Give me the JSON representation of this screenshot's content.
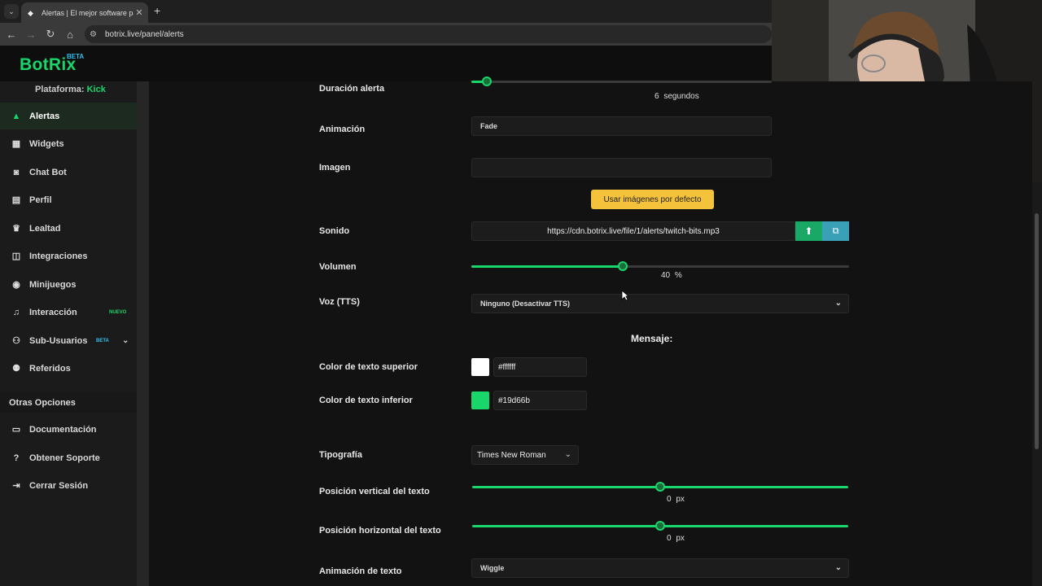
{
  "browser": {
    "tab_title": "Alertas | El mejor software para",
    "url": "botrix.live/panel/alerts"
  },
  "app": {
    "logo": "BotRix",
    "logo_badge": "BETA"
  },
  "sidebar": {
    "platform_label": "Plataforma:",
    "platform_value": "Kick",
    "items": [
      {
        "label": "Alertas",
        "icon": "warning-icon"
      },
      {
        "label": "Widgets",
        "icon": "grid-icon"
      },
      {
        "label": "Chat Bot",
        "icon": "robot-icon"
      },
      {
        "label": "Perfil",
        "icon": "id-card-icon"
      },
      {
        "label": "Lealtad",
        "icon": "trophy-icon"
      },
      {
        "label": "Integraciones",
        "icon": "plug-icon"
      },
      {
        "label": "Minijuegos",
        "icon": "gamepad-icon"
      },
      {
        "label": "Interacción",
        "icon": "music-icon",
        "badge": "NUEVO"
      },
      {
        "label": "Sub-Usuarios",
        "icon": "users-icon",
        "badge": "BETA"
      },
      {
        "label": "Referidos",
        "icon": "user-group-icon"
      }
    ],
    "section_title": "Otras Opciones",
    "other_items": [
      {
        "label": "Documentación",
        "icon": "book-icon"
      },
      {
        "label": "Obtener Soporte",
        "icon": "help-icon"
      },
      {
        "label": "Cerrar Sesión",
        "icon": "logout-icon"
      }
    ]
  },
  "form": {
    "duration_label": "Duración alerta",
    "duration_value": "6",
    "duration_unit": "segundos",
    "animation_label": "Animación",
    "animation_value": "Fade",
    "image_label": "Imagen",
    "image_value": "",
    "default_images_button": "Usar imágenes por defecto",
    "sound_label": "Sonido",
    "sound_value": "https://cdn.botrix.live/file/1/alerts/twitch-bits.mp3",
    "volume_label": "Volumen",
    "volume_value": "40",
    "volume_unit": "%",
    "volume_fraction": 0.4,
    "tts_label": "Voz (TTS)",
    "tts_value": "Ninguno (Desactivar TTS)",
    "message_title": "Mensaje:",
    "top_color_label": "Color de texto superior",
    "top_color_value": "#ffffff",
    "bottom_color_label": "Color de texto inferior",
    "bottom_color_value": "#19d66b",
    "font_label": "Tipografía",
    "font_value": "Times New Roman",
    "vpos_label": "Posición vertical del texto",
    "vpos_value": "0",
    "vpos_unit": "px",
    "hpos_label": "Posición horizontal del texto",
    "hpos_value": "0",
    "hpos_unit": "px",
    "text_anim_label": "Animación de texto",
    "text_anim_value": "Wiggle"
  },
  "colors": {
    "accent": "#19d66b",
    "button_yellow": "#f5c23c"
  }
}
